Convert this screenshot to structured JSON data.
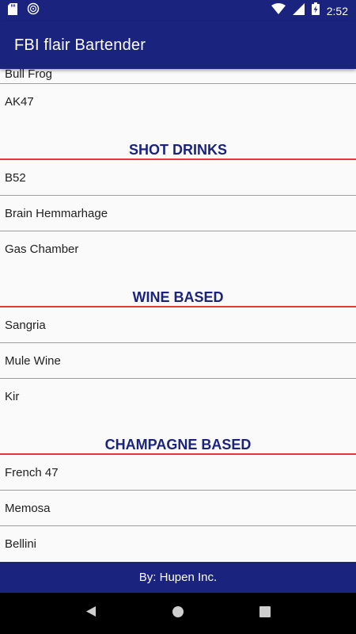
{
  "status_bar": {
    "time": "2:52",
    "icons": [
      "sd-card-icon",
      "sync-icon",
      "wifi-icon",
      "signal-icon",
      "battery-charging-icon"
    ]
  },
  "app_bar": {
    "title": "FBI flair Bartender"
  },
  "list": {
    "partial_top_item": "Bull Frog",
    "pre_items": [
      "AK47"
    ],
    "sections": [
      {
        "title": "SHOT DRINKS",
        "items": [
          "B52",
          "Brain Hemmarhage",
          "Gas Chamber"
        ]
      },
      {
        "title": "WINE BASED",
        "items": [
          "Sangria",
          "Mule Wine",
          "Kir"
        ]
      },
      {
        "title": "CHAMPAGNE BASED",
        "items": [
          "French 47",
          "Memosa",
          "Bellini"
        ]
      }
    ]
  },
  "footer": {
    "text": "By: Hupen Inc."
  },
  "nav": {
    "buttons": [
      "back-icon",
      "home-icon",
      "recents-icon"
    ]
  },
  "colors": {
    "primary": "#1a237e",
    "section_title": "#1a237e",
    "section_divider": "#e53935",
    "background": "#fafafa",
    "nav_bar": "#000000"
  }
}
